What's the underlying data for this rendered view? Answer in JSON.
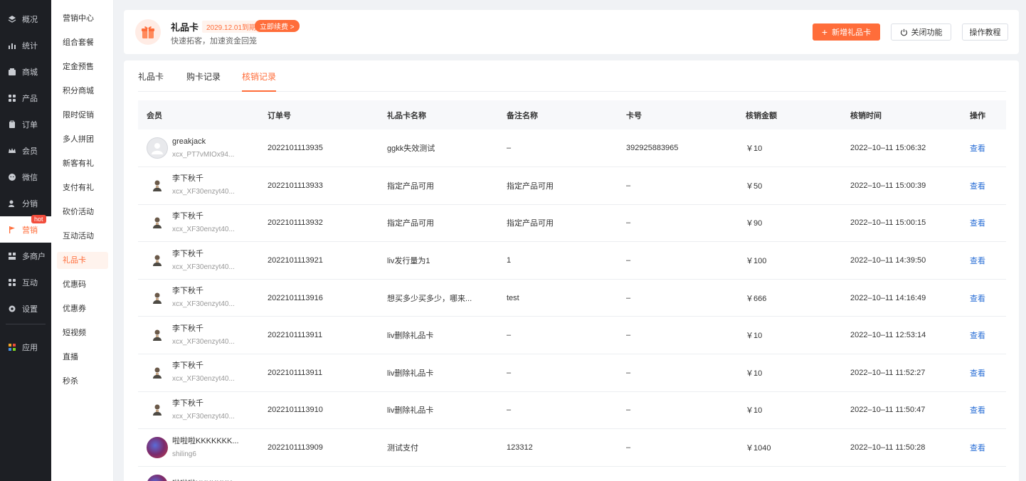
{
  "nav": {
    "items": [
      {
        "label": "概况",
        "icon": "layers-icon"
      },
      {
        "label": "统计",
        "icon": "chart-icon"
      },
      {
        "label": "商城",
        "icon": "store-icon"
      },
      {
        "label": "产品",
        "icon": "grid-icon"
      },
      {
        "label": "订单",
        "icon": "clipboard-icon"
      },
      {
        "label": "会员",
        "icon": "crown-icon"
      },
      {
        "label": "微信",
        "icon": "wechat-icon"
      },
      {
        "label": "分销",
        "icon": "distribution-icon"
      },
      {
        "label": "营销",
        "icon": "flag-icon"
      },
      {
        "label": "多商户",
        "icon": "merchant-icon"
      },
      {
        "label": "互动",
        "icon": "interact-icon"
      },
      {
        "label": "设置",
        "icon": "gear-icon"
      },
      {
        "label": "应用",
        "icon": "apps-icon"
      }
    ],
    "hot_badge": "hot",
    "accent_color": "#ff6d3a"
  },
  "subnav": {
    "items": [
      "营销中心",
      "组合套餐",
      "定金预售",
      "积分商城",
      "限时促销",
      "多人拼团",
      "新客有礼",
      "支付有礼",
      "砍价活动",
      "互动活动",
      "礼品卡",
      "优惠码",
      "优惠券",
      "短视频",
      "直播",
      "秒杀"
    ],
    "active": "礼品卡"
  },
  "header": {
    "title": "礼品卡",
    "expire": "2029.12.01到期",
    "renew": "立即续费 >",
    "subtitle": "快速拓客，加速资金回笼",
    "add_button": "新增礼品卡",
    "close_button": "关闭功能",
    "tutorial_button": "操作教程"
  },
  "tabs": [
    "礼品卡",
    "购卡记录",
    "核销记录"
  ],
  "active_tab": "核销记录",
  "table": {
    "headers": [
      "会员",
      "订单号",
      "礼品卡名称",
      "备注名称",
      "卡号",
      "核销金额",
      "核销时间",
      "操作"
    ],
    "rows": [
      {
        "avatar": "default",
        "name": "greakjack",
        "id": "xcx_PT7vMIOx94...",
        "order": "2022101113935",
        "card_name": "ggkk失效测试",
        "remark": "–",
        "card_no": "392925883965",
        "amount": "￥10",
        "time": "2022–10–11 15:06:32",
        "action": "查看"
      },
      {
        "avatar": "person",
        "name": "李下秋千",
        "id": "xcx_XF30enzyt40...",
        "order": "2022101113933",
        "card_name": "指定产品可用",
        "remark": "指定产品可用",
        "card_no": "–",
        "amount": "￥50",
        "time": "2022–10–11 15:00:39",
        "action": "查看"
      },
      {
        "avatar": "person",
        "name": "李下秋千",
        "id": "xcx_XF30enzyt40...",
        "order": "2022101113932",
        "card_name": "指定产品可用",
        "remark": "指定产品可用",
        "card_no": "–",
        "amount": "￥90",
        "time": "2022–10–11 15:00:15",
        "action": "查看"
      },
      {
        "avatar": "person",
        "name": "李下秋千",
        "id": "xcx_XF30enzyt40...",
        "order": "2022101113921",
        "card_name": "liv发行量为1",
        "remark": "1",
        "card_no": "–",
        "amount": "￥100",
        "time": "2022–10–11 14:39:50",
        "action": "查看"
      },
      {
        "avatar": "person",
        "name": "李下秋千",
        "id": "xcx_XF30enzyt40...",
        "order": "2022101113916",
        "card_name": "想买多少买多少，哪来...",
        "remark": "test",
        "card_no": "–",
        "amount": "￥666",
        "time": "2022–10–11 14:16:49",
        "action": "查看"
      },
      {
        "avatar": "person",
        "name": "李下秋千",
        "id": "xcx_XF30enzyt40...",
        "order": "2022101113911",
        "card_name": "liv删除礼品卡",
        "remark": "–",
        "card_no": "–",
        "amount": "￥10",
        "time": "2022–10–11 12:53:14",
        "action": "查看"
      },
      {
        "avatar": "person",
        "name": "李下秋千",
        "id": "xcx_XF30enzyt40...",
        "order": "2022101113911",
        "card_name": "liv删除礼品卡",
        "remark": "–",
        "card_no": "–",
        "amount": "￥10",
        "time": "2022–10–11 11:52:27",
        "action": "查看"
      },
      {
        "avatar": "person",
        "name": "李下秋千",
        "id": "xcx_XF30enzyt40...",
        "order": "2022101113910",
        "card_name": "liv删除礼品卡",
        "remark": "–",
        "card_no": "–",
        "amount": "￥10",
        "time": "2022–10–11 11:50:47",
        "action": "查看"
      },
      {
        "avatar": "photo",
        "name": "啦啦啦KKKKKKK...",
        "id": "shiling6",
        "order": "2022101113909",
        "card_name": "测试支付",
        "remark": "123312",
        "card_no": "–",
        "amount": "￥1040",
        "time": "2022–10–11 11:50:28",
        "action": "查看"
      },
      {
        "avatar": "photo",
        "name": "啦啦啦KKKKKKK...",
        "id": "",
        "order": "",
        "card_name": "",
        "remark": "",
        "card_no": "",
        "amount": "",
        "time": "",
        "action": ""
      }
    ]
  }
}
